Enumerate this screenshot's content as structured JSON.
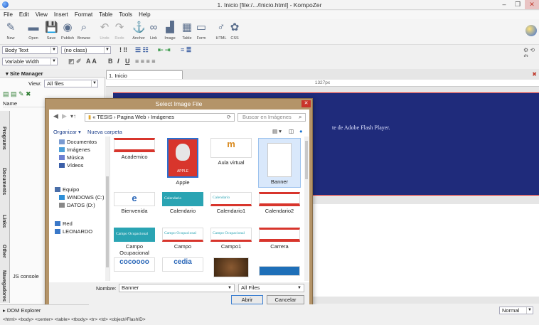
{
  "window": {
    "title": "1. Inicio [file:/.../Inicio.html] - KompoZer",
    "minimize": "–",
    "maximize": "❐",
    "close": "✕"
  },
  "menu": [
    "File",
    "Edit",
    "View",
    "Insert",
    "Format",
    "Table",
    "Tools",
    "Help"
  ],
  "toolbar": [
    {
      "label": "New",
      "icon": "new-icon",
      "glyph": "✎"
    },
    {
      "label": "Open",
      "icon": "open-icon",
      "glyph": "▬"
    },
    {
      "label": "Save",
      "icon": "save-icon",
      "glyph": "💾"
    },
    {
      "label": "Publish",
      "icon": "publish-icon",
      "glyph": "◉"
    },
    {
      "label": "Browse",
      "icon": "browse-icon",
      "glyph": "⌕"
    },
    {
      "label": "Undo",
      "icon": "undo-icon",
      "glyph": "↶",
      "disabled": true
    },
    {
      "label": "Redo",
      "icon": "redo-icon",
      "glyph": "↷",
      "disabled": true
    },
    {
      "label": "Anchor",
      "icon": "anchor-icon",
      "glyph": "⚓"
    },
    {
      "label": "Link",
      "icon": "link-icon",
      "glyph": "∞"
    },
    {
      "label": "Image",
      "icon": "image-icon",
      "glyph": "▟"
    },
    {
      "label": "Table",
      "icon": "table-icon",
      "glyph": "▦"
    },
    {
      "label": "Form",
      "icon": "form-icon",
      "glyph": "▭"
    },
    {
      "label": "HTML",
      "icon": "html-icon",
      "glyph": "♂"
    },
    {
      "label": "CSS",
      "icon": "css-icon",
      "glyph": "✿"
    }
  ],
  "format": {
    "paragraph_style": "Body Text",
    "class": "(no class)",
    "width": "Variable Width"
  },
  "site_manager": {
    "title": "Site Manager",
    "view_label": "View:",
    "view_value": "All files",
    "column_name": "Name",
    "console": "JS console",
    "dom_explorer": "DOM Explorer"
  },
  "vtabs": [
    "Programs",
    "Documents",
    "Links",
    "Other",
    "Navegadores"
  ],
  "document": {
    "tab": "1. Inicio",
    "ruler": "1327px",
    "flash_message": "te de Adobe Flash Player.",
    "view_mode": "Normal"
  },
  "dialog": {
    "title": "Select Image File",
    "breadcrumb": "« TESIS › Pagina Web › Imágenes",
    "search_placeholder": "Buscar en Imágenes",
    "organize": "Organizar ▾",
    "new_folder": "Nueva carpeta",
    "nav": [
      "Documentos",
      "Imágenes",
      "Música",
      "Vídeos",
      "Equipo",
      "WINDOWS (C:)",
      "DATOS (D:)",
      "Red",
      "LEONARDO"
    ],
    "files": [
      {
        "caption": "Academico",
        "kind": "banner"
      },
      {
        "caption": "Apple",
        "kind": "apple",
        "badge": "APPLE"
      },
      {
        "caption": "Aula virtual",
        "kind": "logo",
        "mark": "m"
      },
      {
        "caption": "Banner",
        "kind": "file",
        "selected": true
      },
      {
        "caption": "Bienvenida",
        "kind": "logo",
        "mark": "e"
      },
      {
        "caption": "Calendario",
        "kind": "teal",
        "text": "Calendario"
      },
      {
        "caption": "Calendario1",
        "kind": "light",
        "text": "Calendario"
      },
      {
        "caption": "Calendario2",
        "kind": "banner"
      },
      {
        "caption": "Campo Ocupacional",
        "kind": "teal",
        "text": "Campo Ocupacional"
      },
      {
        "caption": "Campo",
        "kind": "light",
        "text": "Campo Ocupacional"
      },
      {
        "caption": "Campo1",
        "kind": "light",
        "text": "Campo Ocupacional"
      },
      {
        "caption": "Carrera",
        "kind": "banner"
      },
      {
        "caption": "",
        "kind": "logo",
        "mark": "cocoooo"
      },
      {
        "caption": "",
        "kind": "logo",
        "mark": "cedia"
      },
      {
        "caption": "",
        "kind": "photo"
      },
      {
        "caption": "",
        "kind": "bluebar"
      }
    ],
    "name_label": "Nombre:",
    "name_value": "Banner",
    "filter": "All Files",
    "open": "Abrir",
    "cancel": "Cancelar"
  },
  "statusbar": "<html> <body> <center> <table> <tbody> <tr> <td> <object#FlashID>",
  "colors": {
    "flash_bg": "#1f2b7b",
    "dialog_frame": "#b49469",
    "accent_red": "#c9342b",
    "teal": "#2aa4b3"
  }
}
